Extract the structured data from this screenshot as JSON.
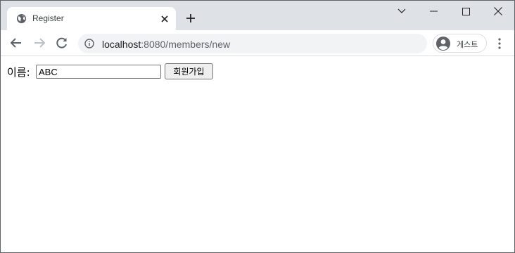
{
  "tab": {
    "title": "Register",
    "icons": {
      "favicon": "globe-icon",
      "close": "close-icon",
      "new_tab": "plus-icon"
    }
  },
  "window_controls": {
    "icons": [
      "chevron-down-icon",
      "minimize-icon",
      "maximize-icon",
      "close-window-icon"
    ]
  },
  "toolbar": {
    "icons": {
      "back": "arrow-left-icon",
      "forward": "arrow-right-icon",
      "reload": "reload-icon",
      "site_info": "info-icon",
      "menu": "more-vert-icon"
    },
    "url_host": "localhost",
    "url_rest": ":8080/members/new",
    "profile_label": "게스트"
  },
  "form": {
    "name_label": "이름:",
    "name_value": "ABC",
    "submit_label": "회원가입"
  },
  "colors": {
    "tabstrip_bg": "#dee1e6",
    "omnibox_bg": "#f1f3f4",
    "icon_color": "#5f6368"
  }
}
